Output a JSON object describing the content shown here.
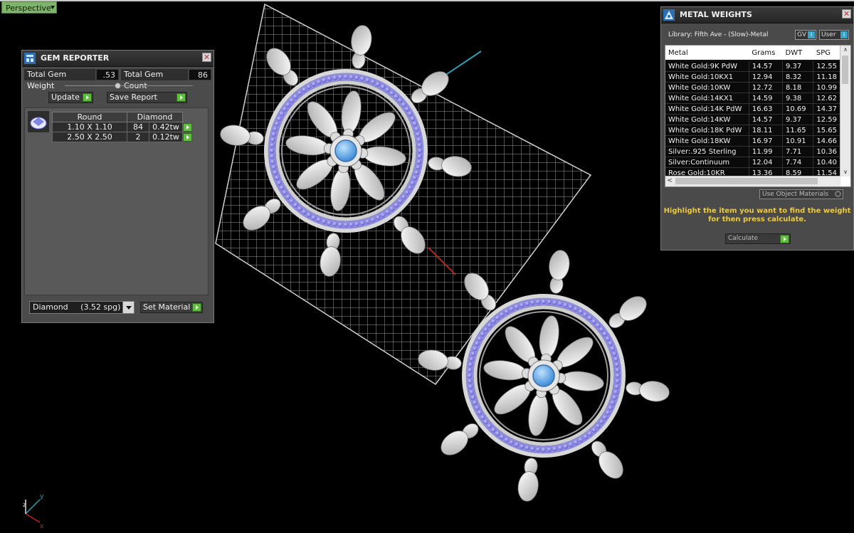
{
  "viewport": {
    "label": "Perspective",
    "axis_labels": {
      "x": "x",
      "y": "y",
      "z": "z"
    }
  },
  "gem_reporter": {
    "title": "GEM REPORTER",
    "total_weight_label": "Total Gem Weight",
    "total_weight_value": ".53",
    "total_count_label": "Total Gem Count",
    "total_count_value": "86",
    "update_label": "Update",
    "save_report_label": "Save Report",
    "headers": [
      "Round",
      "Diamond"
    ],
    "rows": [
      {
        "size": "1.10 X 1.10",
        "count": "84",
        "weight": "0.42tw"
      },
      {
        "size": "2.50 X 2.50",
        "count": "2",
        "weight": "0.12tw"
      }
    ],
    "material_value": "Diamond     (3.52 spg)",
    "set_material_label": "Set Material"
  },
  "metal_weights": {
    "title": "METAL WEIGHTS",
    "library": "Library: Fifth Ave - (Slow)-Metal",
    "gv_label": "GV",
    "user_label": "User",
    "columns": [
      "Metal",
      "Grams",
      "DWT",
      "SPG"
    ],
    "rows": [
      [
        "White Gold:9K PdW",
        "14.57",
        "9.37",
        "12.55"
      ],
      [
        "White Gold:10KX1",
        "12.94",
        "8.32",
        "11.18"
      ],
      [
        "White Gold:10KW",
        "12.72",
        "8.18",
        "10.99"
      ],
      [
        "White Gold:14KX1",
        "14.59",
        "9.38",
        "12.62"
      ],
      [
        "White Gold:14K PdW",
        "16.63",
        "10.69",
        "14.37"
      ],
      [
        "White Gold:14KW",
        "14.57",
        "9.37",
        "12.59"
      ],
      [
        "White Gold:18K PdW",
        "18.11",
        "11.65",
        "15.65"
      ],
      [
        "White Gold:18KW",
        "16.97",
        "10.91",
        "14.66"
      ],
      [
        "Silver:.925 Sterling",
        "11.99",
        "7.71",
        "10.36"
      ],
      [
        "Silver:Continuum",
        "12.04",
        "7.74",
        "10.40"
      ],
      [
        "Rose Gold:10KR",
        "13.36",
        "8.59",
        "11.54"
      ]
    ],
    "use_object_materials": "Use Object Materials",
    "hint": "Highlight the item you want to find the weight for then press calculate.",
    "calculate_label": "Calculate"
  }
}
